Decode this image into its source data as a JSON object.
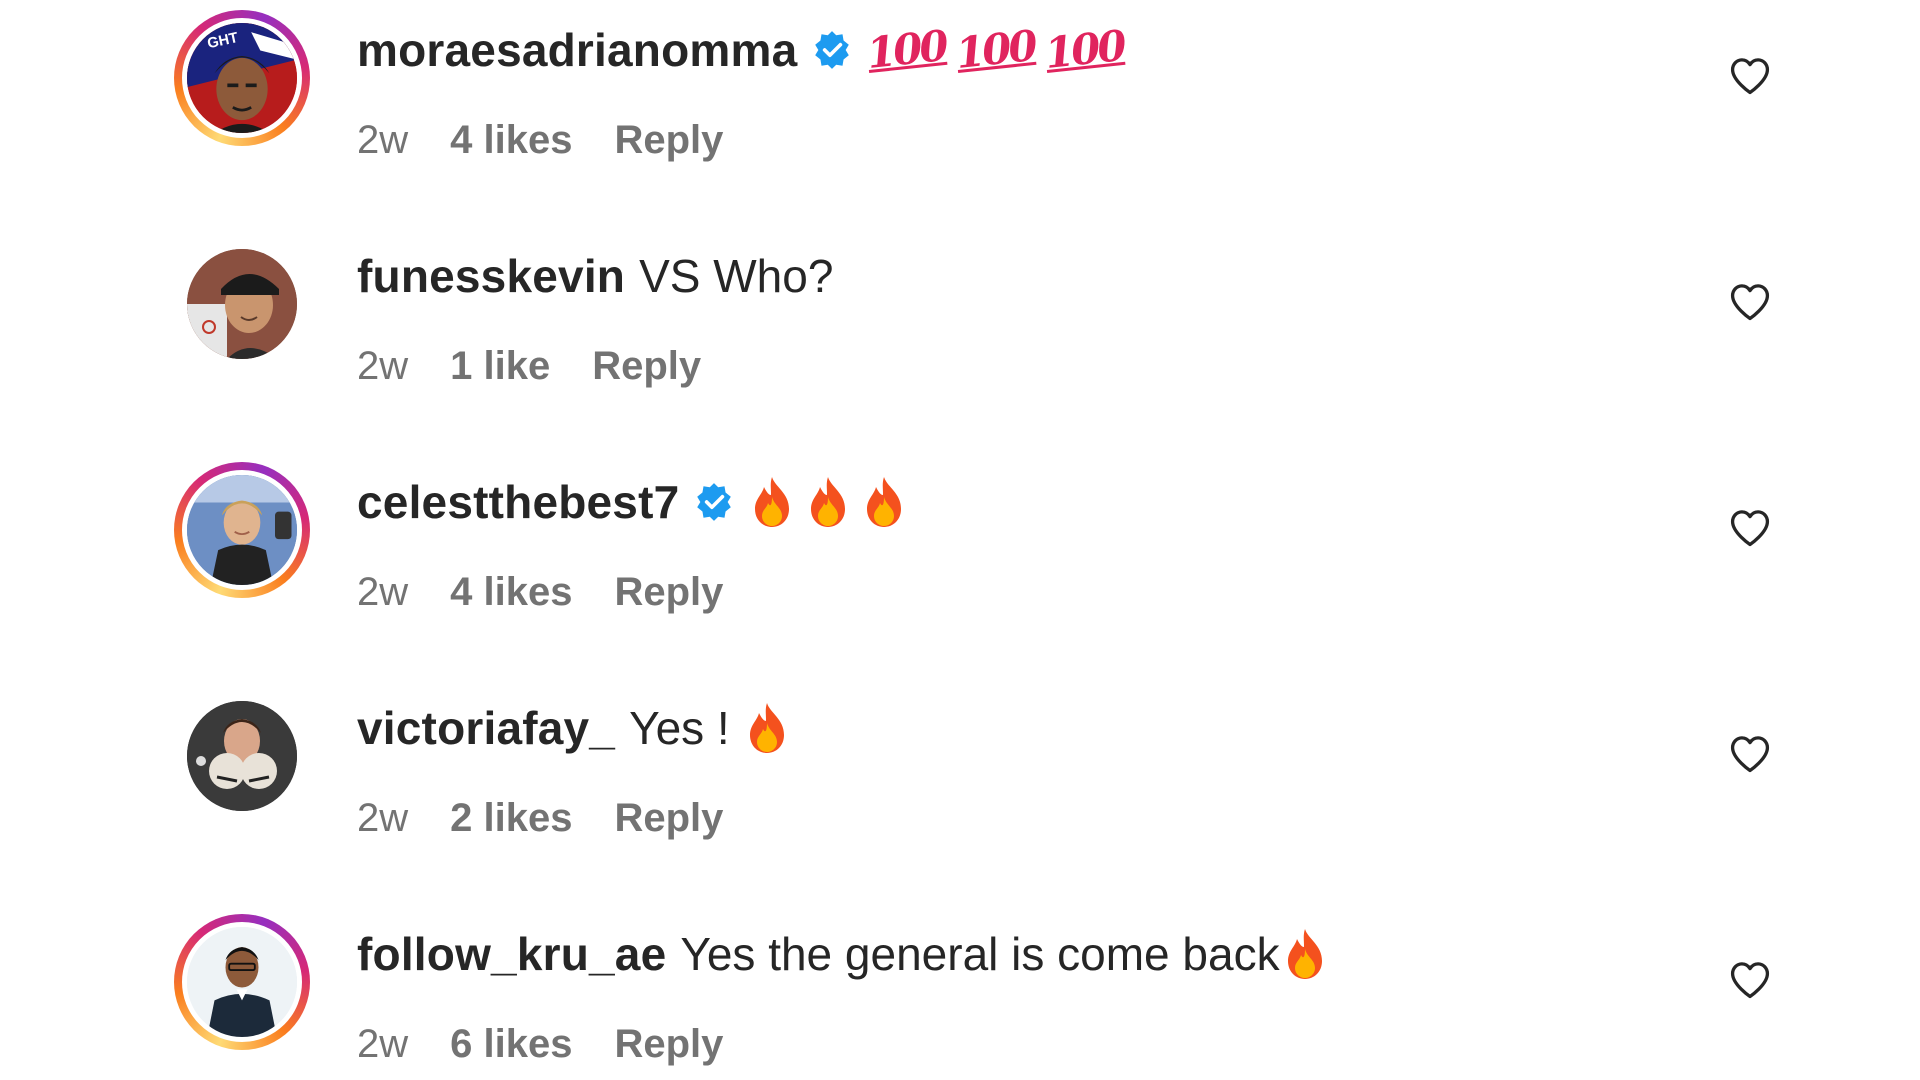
{
  "comments": [
    {
      "username": "moraesadrianomma",
      "verified": true,
      "text": "",
      "emoji": [
        "💯",
        "💯",
        "💯"
      ],
      "emoji_icon": "hundred-points-icon",
      "time": "2w",
      "likes": "4 likes",
      "reply": "Reply",
      "story_ring": true
    },
    {
      "username": "funesskevin",
      "verified": false,
      "text": "VS Who?",
      "emoji": [],
      "time": "2w",
      "likes": "1 like",
      "reply": "Reply",
      "story_ring": false
    },
    {
      "username": "celestthebest7",
      "verified": true,
      "text": "",
      "emoji": [
        "🔥",
        "🔥",
        "🔥"
      ],
      "emoji_icon": "fire-icon",
      "time": "2w",
      "likes": "4 likes",
      "reply": "Reply",
      "story_ring": true
    },
    {
      "username": "victoriafay_",
      "verified": false,
      "text": "Yes !",
      "emoji": [
        "🔥"
      ],
      "emoji_icon": "fire-icon",
      "time": "2w",
      "likes": "2 likes",
      "reply": "Reply",
      "story_ring": false
    },
    {
      "username": "follow_kru_ae",
      "verified": false,
      "text": "Yes the general is come back",
      "emoji": [
        "🔥"
      ],
      "emoji_icon": "fire-icon",
      "time": "2w",
      "likes": "6 likes",
      "reply": "Reply",
      "story_ring": true
    }
  ],
  "colors": {
    "text_primary": "#262626",
    "text_secondary": "#737373",
    "verified_blue": "#1d9bf0",
    "hundred_red": "#e0245e",
    "background": "#ffffff"
  },
  "icons": {
    "like": "heart-outline-icon",
    "verified": "verified-badge-icon"
  }
}
